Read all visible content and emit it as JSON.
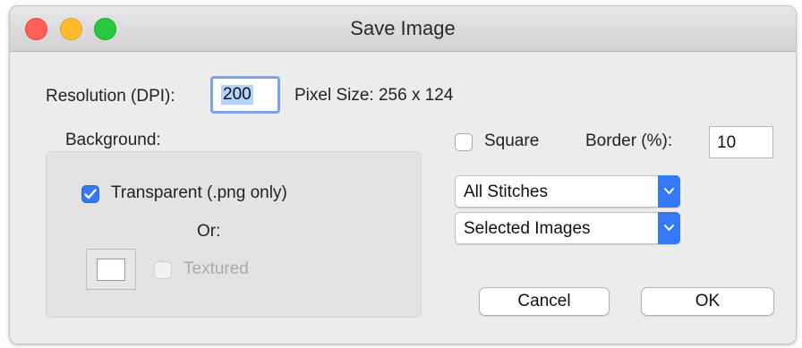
{
  "window": {
    "title": "Save Image"
  },
  "resolution": {
    "label": "Resolution (DPI):",
    "value": "200"
  },
  "pixel_size": {
    "text": "Pixel Size: 256 x 124"
  },
  "background": {
    "label": "Background:",
    "transparent_label": "Transparent (.png only)",
    "transparent_checked": true,
    "or_label": "Or:",
    "textured_label": "Textured",
    "textured_checked": false,
    "textured_enabled": false
  },
  "square": {
    "label": "Square",
    "checked": false
  },
  "border": {
    "label": "Border (%):",
    "value": "10"
  },
  "popups": {
    "stitches": "All Stitches",
    "images": "Selected Images"
  },
  "buttons": {
    "cancel": "Cancel",
    "ok": "OK"
  },
  "colors": {
    "accent": "#3478f6",
    "focus_ring": "#7ca3e6",
    "selection": "#b3d2fd"
  }
}
